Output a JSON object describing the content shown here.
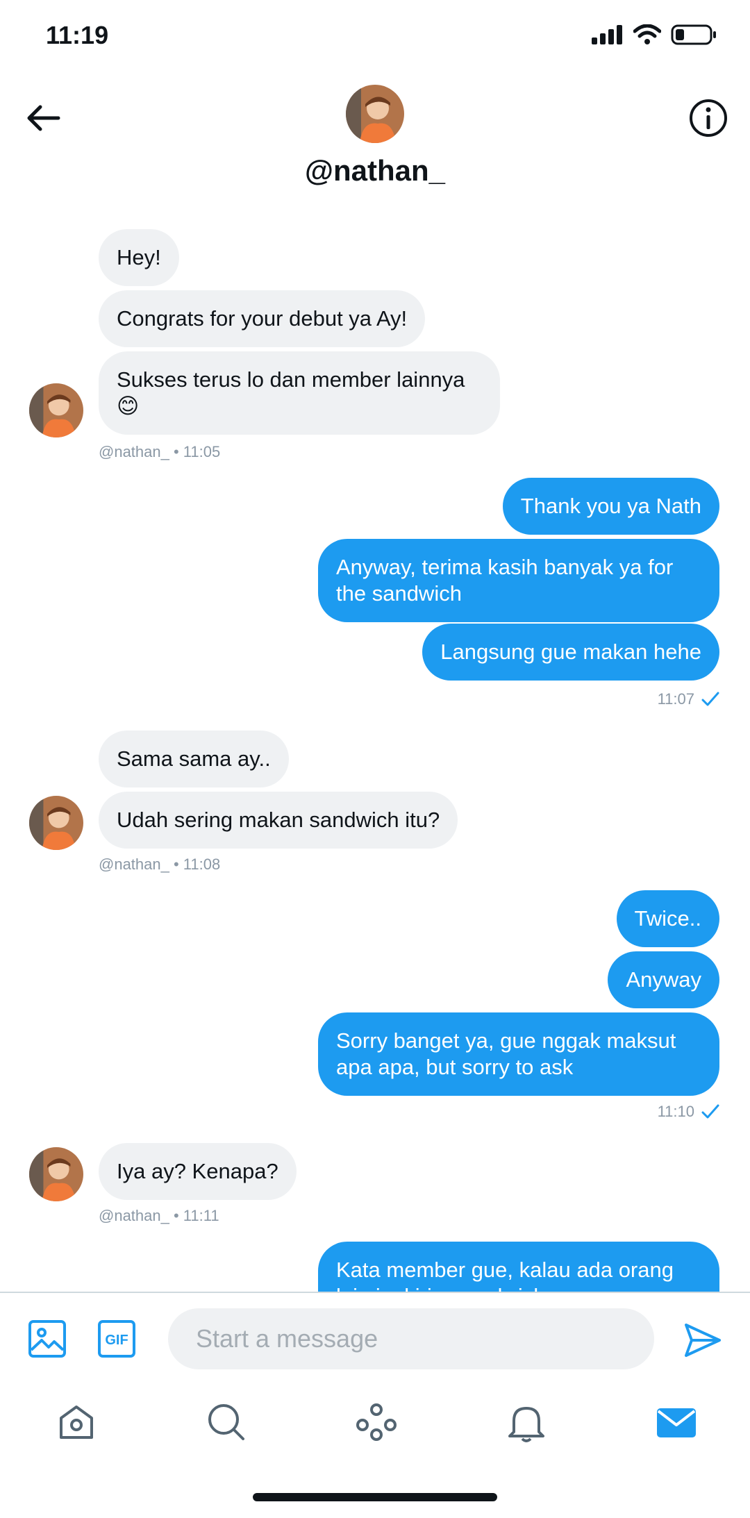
{
  "status_bar": {
    "time": "11:19"
  },
  "header": {
    "username": "@nathan_"
  },
  "messages": {
    "m1": "Hey!",
    "m2": "Congrats for your debut ya Ay!",
    "m3": "Sukses terus lo dan member lainnya",
    "m3_emoji": "😊",
    "meta1": "@nathan_  • 11:05",
    "m4": "Thank you ya Nath",
    "m5": "Anyway, terima kasih banyak ya for the sandwich",
    "m6": "Langsung gue makan hehe",
    "meta2": "11:07",
    "m7": "Sama sama ay..",
    "m8": "Udah sering makan sandwich itu?",
    "meta3": "@nathan_  • 11:08",
    "m9": "Twice..",
    "m10": "Anyway",
    "m11": "Sorry banget ya, gue nggak maksut apa apa, but sorry to ask",
    "meta4": "11:10",
    "m12": "Iya ay? Kenapa?",
    "meta5": "@nathan_  • 11:11",
    "m13": "Kata member gue, kalau ada orang lain ingkirim sandwich"
  },
  "composer": {
    "placeholder": "Start a message",
    "gif_label": "GIF"
  },
  "colors": {
    "accent": "#1d9bf0",
    "received_bubble": "#eff1f3"
  },
  "icons": [
    "back-arrow-icon",
    "info-icon",
    "image-icon",
    "gif-icon",
    "send-icon",
    "home-icon",
    "search-icon",
    "spaces-icon",
    "bell-icon",
    "mail-icon"
  ]
}
